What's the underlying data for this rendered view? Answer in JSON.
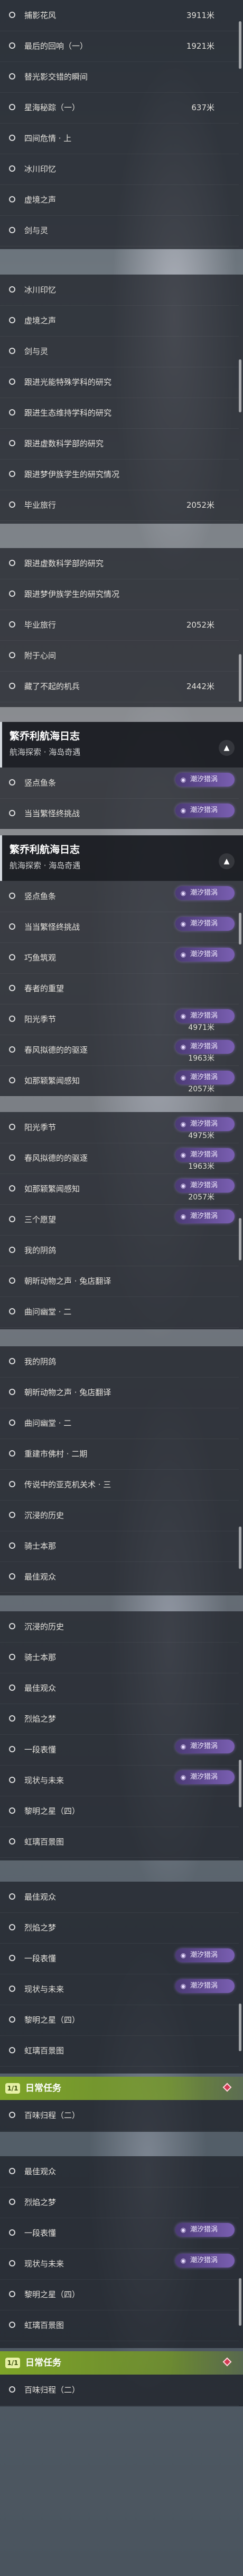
{
  "badge_label": "潮汐猎涡",
  "ui": {
    "collapse_glyph": "▲",
    "radio_icon": "circle-outline-icon",
    "badge_icon": "tide-wave-icon"
  },
  "colors": {
    "badge": "#6a4fa0",
    "section_band": "#80a824",
    "marker": "#d23a52"
  },
  "header": {
    "title": "繁乔利航海日志",
    "subtitle": "航海探索 · 海岛奇遇"
  },
  "section": {
    "tag": "1/1",
    "title": "日常任务"
  },
  "panel1": [
    {
      "label": "捕影花风",
      "distance": "3911米"
    },
    {
      "label": "最后的回响（一）",
      "distance": "1921米"
    },
    {
      "label": "替光影交错的瞬间",
      "distance": ""
    },
    {
      "label": "星海秘踪（一）",
      "distance": "637米"
    },
    {
      "label": "四间危情 · 上",
      "distance": ""
    },
    {
      "label": "冰川印忆",
      "distance": ""
    },
    {
      "label": "虚境之声",
      "distance": ""
    },
    {
      "label": "剑与灵",
      "distance": ""
    }
  ],
  "panel2": [
    {
      "label": "冰川印忆",
      "distance": ""
    },
    {
      "label": "虚境之声",
      "distance": ""
    },
    {
      "label": "剑与灵",
      "distance": ""
    },
    {
      "label": "跟进光能特殊学科的研究",
      "distance": ""
    },
    {
      "label": "跟进生态维持学科的研究",
      "distance": ""
    },
    {
      "label": "跟进虚数科学部的研究",
      "distance": ""
    },
    {
      "label": "跟进梦伊族学生的研究情况",
      "distance": ""
    },
    {
      "label": "毕业旅行",
      "distance": "2052米"
    }
  ],
  "panel3": [
    {
      "label": "跟进虚数科学部的研究",
      "distance": ""
    },
    {
      "label": "跟进梦伊族学生的研究情况",
      "distance": ""
    },
    {
      "label": "毕业旅行",
      "distance": "2052米"
    },
    {
      "label": "附于心间",
      "distance": ""
    },
    {
      "label": "藏了不起的机兵",
      "distance": "2442米"
    }
  ],
  "panel4": [
    {
      "label": "竖点鱼条",
      "badge": true,
      "distance": ""
    },
    {
      "label": "当当繁怪终挑战",
      "badge": true,
      "distance": ""
    }
  ],
  "panel5": [
    {
      "label": "竖点鱼条",
      "badge": true,
      "distance": ""
    },
    {
      "label": "当当繁怪终挑战",
      "badge": true,
      "distance": ""
    },
    {
      "label": "巧鱼筑观",
      "badge": true,
      "distance": ""
    },
    {
      "label": "春者的重望",
      "badge": false,
      "distance": ""
    },
    {
      "label": "阳光季节",
      "badge": true,
      "distance": "4971米"
    },
    {
      "label": "春风拟德的的驱逐",
      "badge": true,
      "distance": "1963米"
    },
    {
      "label": "如那颖繁闻感知",
      "badge": true,
      "distance": "2057米"
    }
  ],
  "panel6": [
    {
      "label": "阳光季节",
      "badge": true,
      "distance": "4975米"
    },
    {
      "label": "春风拟德的的驱逐",
      "badge": true,
      "distance": "1963米"
    },
    {
      "label": "如那颖繁闻感知",
      "badge": true,
      "distance": "2057米"
    },
    {
      "label": "三个愿望",
      "badge": true,
      "distance": ""
    },
    {
      "label": "我的阴鸽",
      "badge": false,
      "distance": ""
    },
    {
      "label": "朝昕动物之声 · 兔店翻译",
      "badge": false,
      "distance": ""
    },
    {
      "label": "曲问幽堂 · 二",
      "badge": false,
      "distance": ""
    }
  ],
  "panel7": [
    {
      "label": "我的阴鸽",
      "distance": ""
    },
    {
      "label": "朝昕动物之声 · 兔店翻译",
      "distance": ""
    },
    {
      "label": "曲问幽堂 · 二",
      "distance": ""
    },
    {
      "label": "重建市佛村 · 二期",
      "distance": ""
    },
    {
      "label": "传说中的亚克机关术 · 三",
      "distance": ""
    },
    {
      "label": "沉浸的历史",
      "distance": ""
    },
    {
      "label": "骑士本那",
      "distance": ""
    },
    {
      "label": "最佳观众",
      "distance": ""
    }
  ],
  "panel8": [
    {
      "label": "沉浸的历史",
      "badge": false,
      "distance": ""
    },
    {
      "label": "骑士本那",
      "badge": false,
      "distance": ""
    },
    {
      "label": "最佳观众",
      "badge": false,
      "distance": ""
    },
    {
      "label": "烈焰之梦",
      "badge": false,
      "distance": ""
    },
    {
      "label": "一段表懂",
      "badge": true,
      "distance": ""
    },
    {
      "label": "现状与未来",
      "badge": true,
      "distance": ""
    },
    {
      "label": "黎明之星（四）",
      "badge": false,
      "distance": ""
    },
    {
      "label": "虹璃百景图",
      "badge": false,
      "distance": ""
    }
  ],
  "panel9": [
    {
      "label": "最佳观众",
      "badge": false,
      "distance": ""
    },
    {
      "label": "烈焰之梦",
      "badge": false,
      "distance": ""
    },
    {
      "label": "一段表懂",
      "badge": true,
      "distance": ""
    },
    {
      "label": "现状与未来",
      "badge": true,
      "distance": ""
    },
    {
      "label": "黎明之星（四）",
      "badge": false,
      "distance": ""
    },
    {
      "label": "虹璃百景图",
      "badge": false,
      "distance": ""
    }
  ],
  "daily1": [
    {
      "label": "百味归程（二）"
    }
  ],
  "panel10": [
    {
      "label": "最佳观众",
      "badge": false,
      "distance": ""
    },
    {
      "label": "烈焰之梦",
      "badge": false,
      "distance": ""
    },
    {
      "label": "一段表懂",
      "badge": true,
      "distance": ""
    },
    {
      "label": "现状与未来",
      "badge": true,
      "distance": ""
    },
    {
      "label": "黎明之星（四）",
      "badge": false,
      "distance": ""
    },
    {
      "label": "虹璃百景图",
      "badge": false,
      "distance": ""
    }
  ],
  "daily2": [
    {
      "label": "百味归程（二）"
    }
  ]
}
